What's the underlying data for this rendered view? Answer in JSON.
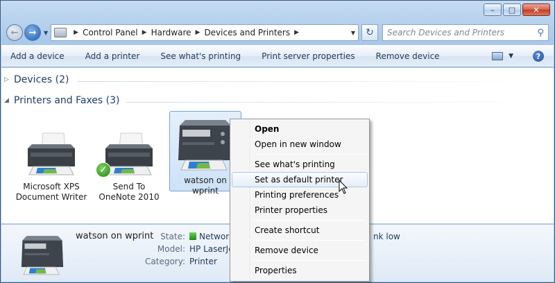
{
  "window": {
    "caption_buttons": [
      "minimize",
      "maximize",
      "close"
    ]
  },
  "nav": {
    "breadcrumbs": [
      "Control Panel",
      "Hardware",
      "Devices and Printers"
    ],
    "search_placeholder": "Search Devices and Printers"
  },
  "commands": [
    "Add a device",
    "Add a printer",
    "See what's printing",
    "Print server properties",
    "Remove device"
  ],
  "groups": {
    "devices": "Devices (2)",
    "printers": "Printers and Faxes (3)"
  },
  "printers": [
    {
      "name_line1": "Microsoft XPS",
      "name_line2": "Document Writer",
      "default": false,
      "selected": false
    },
    {
      "name_line1": "Send To",
      "name_line2": "OneNote 2010",
      "default": true,
      "selected": false
    },
    {
      "name_line1": "watson on wprint",
      "name_line2": "",
      "default": false,
      "selected": true
    }
  ],
  "details": {
    "name": "watson on wprint",
    "state_label": "State:",
    "state_value": "Networ",
    "state_extra": "nk low",
    "model_label": "Model:",
    "model_value": "HP LaserJet",
    "category_label": "Category:",
    "category_value": "Printer"
  },
  "context_menu": {
    "items": [
      {
        "label": "Open",
        "bold": true
      },
      {
        "label": "Open in new window"
      },
      {
        "label": "See what's printing"
      },
      {
        "label": "Set as default printer",
        "hover": true
      },
      {
        "label": "Printing preferences"
      },
      {
        "label": "Printer properties"
      },
      {
        "label": "Create shortcut"
      },
      {
        "label": "Remove device"
      },
      {
        "label": "Properties"
      }
    ]
  },
  "icons": {
    "minimize": "minimize-icon",
    "maximize": "maximize-icon",
    "close": "close-icon",
    "back": "back-arrow-icon",
    "forward": "forward-arrow-icon",
    "refresh": "refresh-icon",
    "search": "search-icon",
    "help": "help-icon",
    "views": "views-icon",
    "printer": "printer-icon",
    "default_check": "checkmark-icon",
    "cursor": "mouse-cursor-icon"
  },
  "colors": {
    "accent": "#1e3d6e",
    "selection": "#cde2f8",
    "default_check": "#23851a"
  }
}
